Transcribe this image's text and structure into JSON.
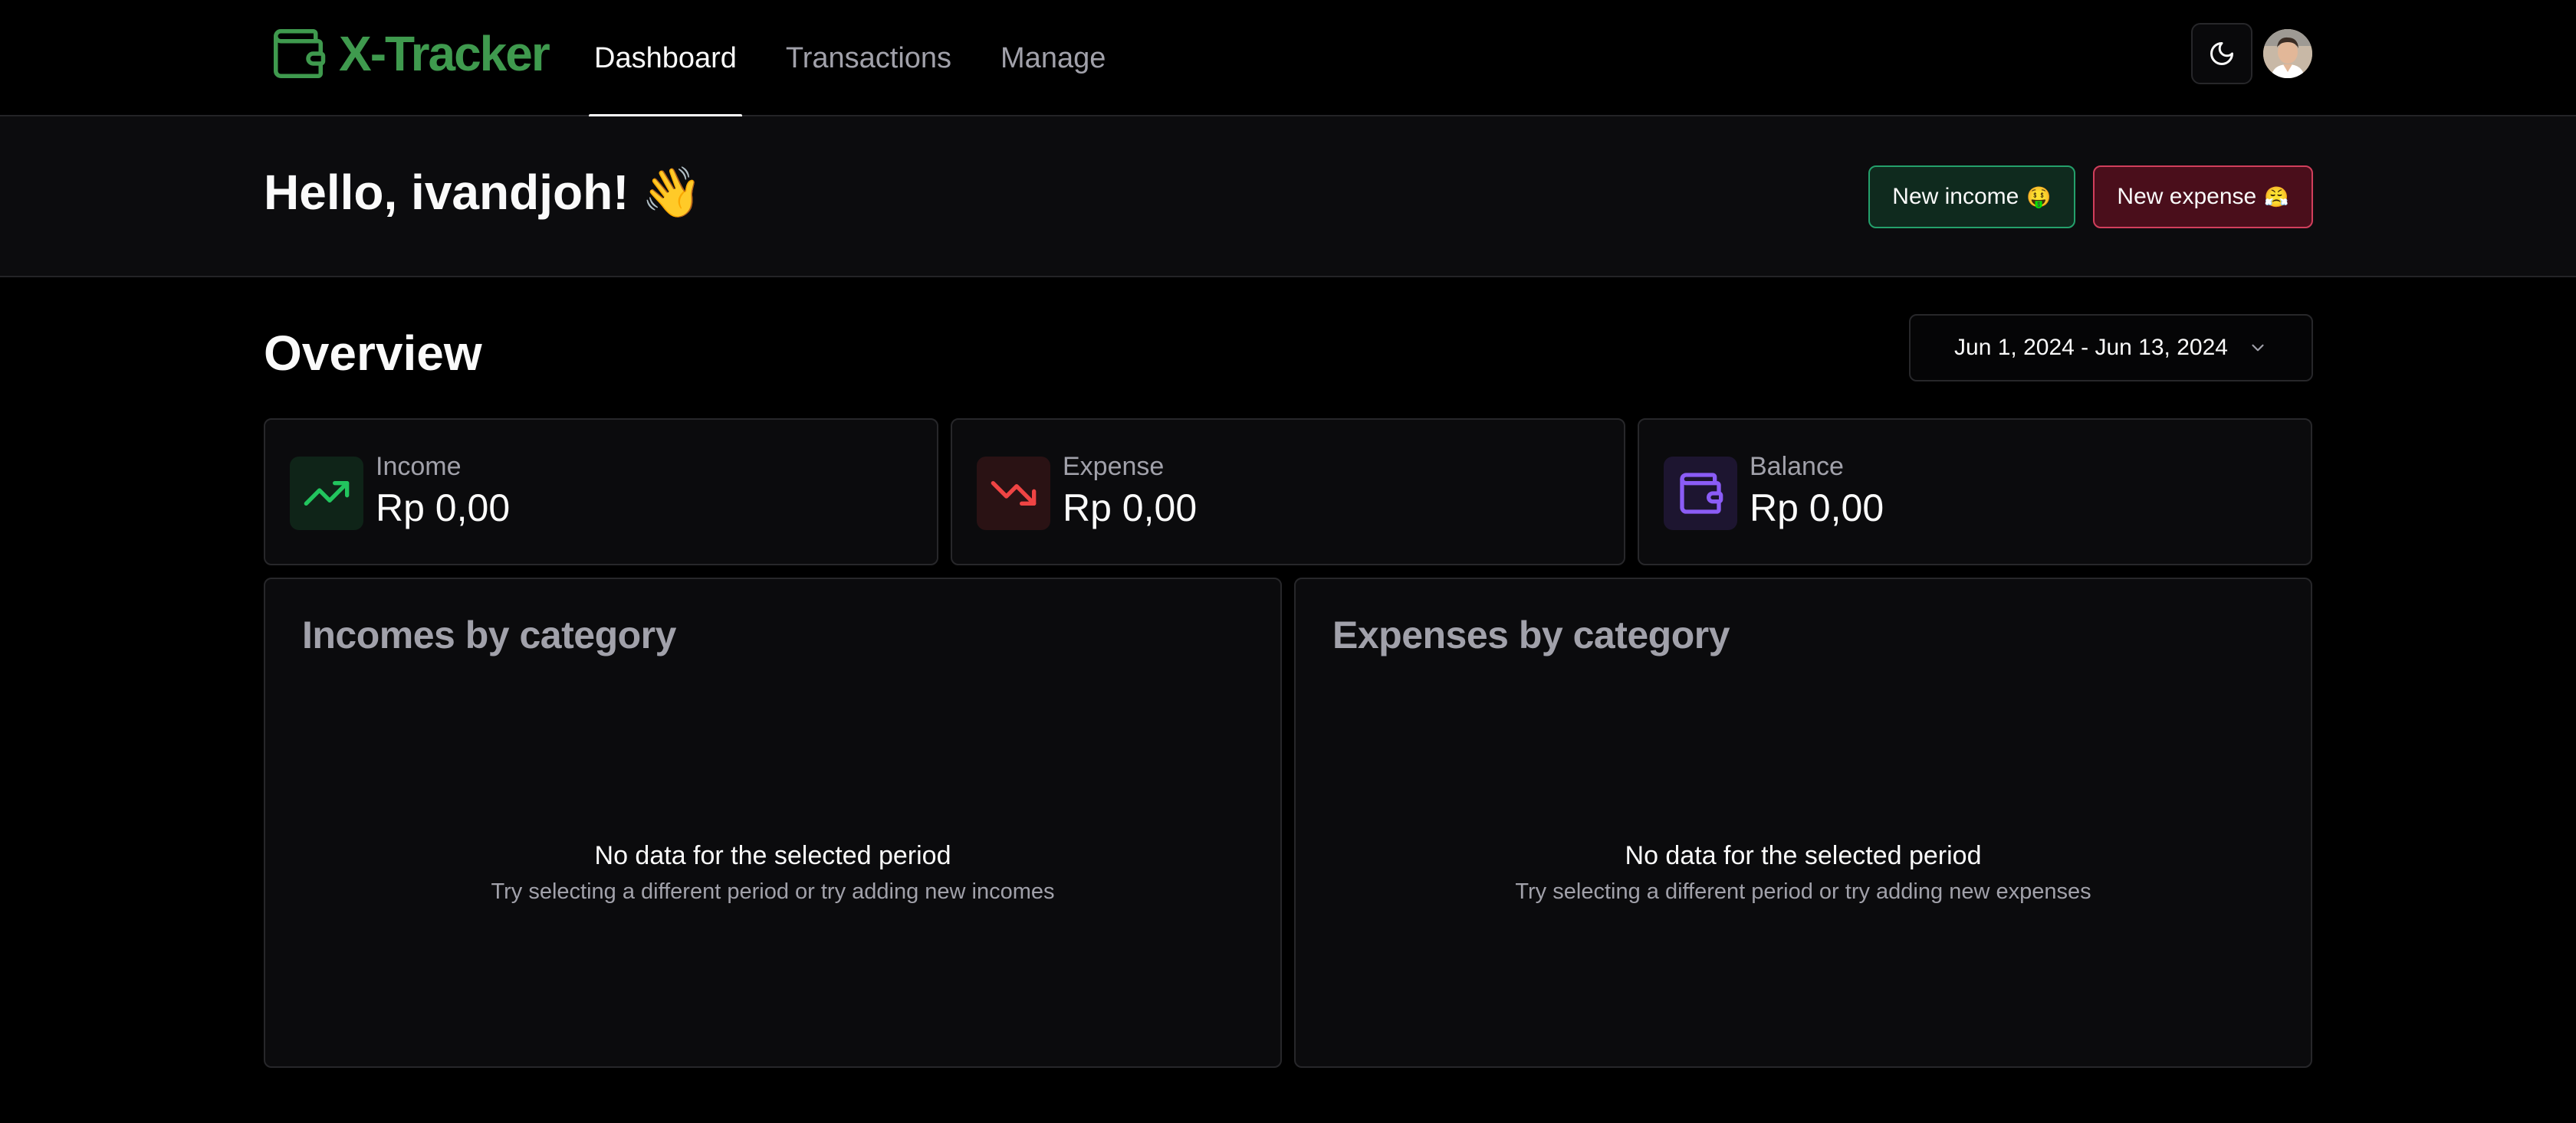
{
  "app": {
    "name": "X-Tracker",
    "brand_color": "#3f9a4e"
  },
  "nav": {
    "links": [
      {
        "label": "Dashboard",
        "active": true
      },
      {
        "label": "Transactions",
        "active": false
      },
      {
        "label": "Manage",
        "active": false
      }
    ],
    "theme_icon": "moon-icon",
    "avatar_icon": "user-avatar"
  },
  "greeting": {
    "text": "Hello, ivandjoh!",
    "emoji": "👋"
  },
  "actions": {
    "new_income_label": "New income",
    "new_income_emoji": "🤑",
    "new_expense_label": "New expense",
    "new_expense_emoji": "😤"
  },
  "overview": {
    "title": "Overview",
    "date_range": "Jun 1, 2024 - Jun 13, 2024",
    "date_range_icon": "chevron-down-icon"
  },
  "stats": [
    {
      "label": "Income",
      "value": "Rp 0,00",
      "icon": "trending-up-icon",
      "color": "#22c55e"
    },
    {
      "label": "Expense",
      "value": "Rp 0,00",
      "icon": "trending-down-icon",
      "color": "#ef4444"
    },
    {
      "label": "Balance",
      "value": "Rp 0,00",
      "icon": "wallet-icon",
      "color": "#8b5cf6"
    }
  ],
  "incomes_panel": {
    "title": "Incomes by category",
    "empty_title": "No data for the selected period",
    "empty_subtitle": "Try selecting a different period or try adding new incomes"
  },
  "expenses_panel": {
    "title": "Expenses by category",
    "empty_title": "No data for the selected period",
    "empty_subtitle": "Try selecting a different period or try adding new expenses"
  }
}
